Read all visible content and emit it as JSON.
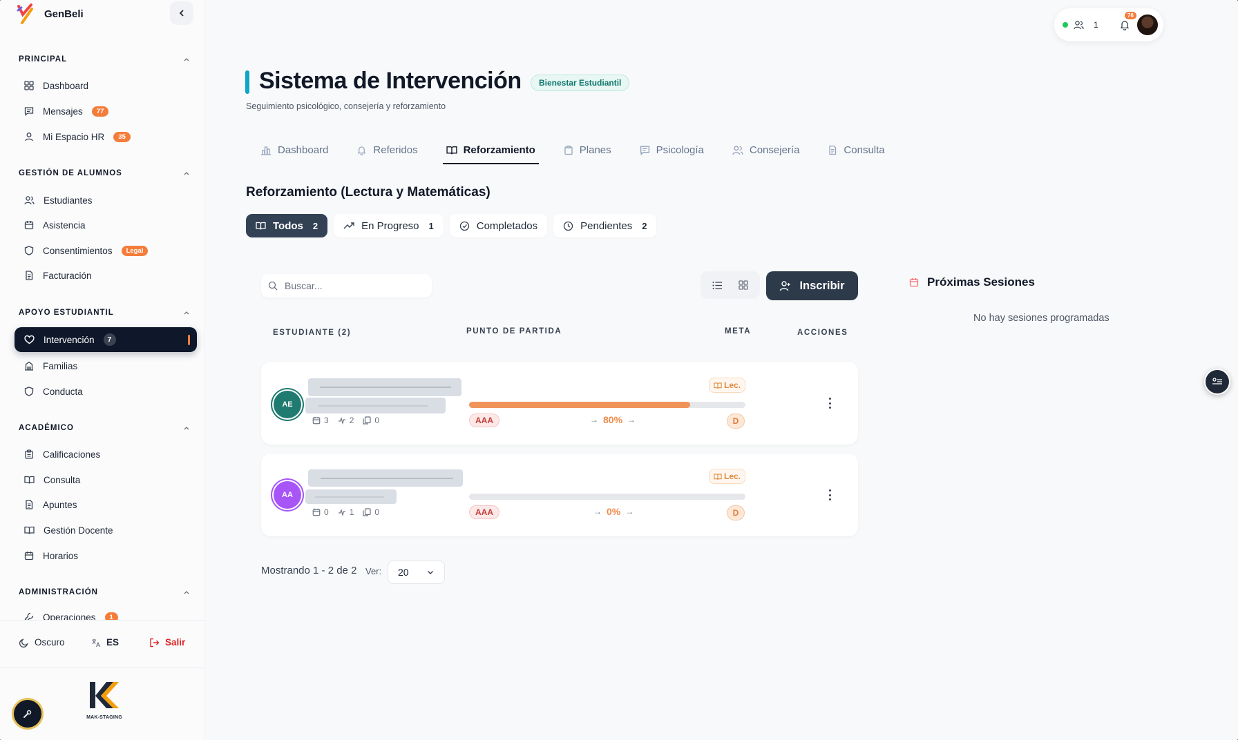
{
  "brand": {
    "name": "GenBeli"
  },
  "sidebar": {
    "sections": [
      {
        "title": "PRINCIPAL"
      },
      {
        "title": "GESTIÓN DE ALUMNOS"
      },
      {
        "title": "APOYO ESTUDIANTIL"
      },
      {
        "title": "ACADÉMICO"
      },
      {
        "title": "ADMINISTRACIÓN"
      }
    ],
    "items": [
      {
        "label": "Dashboard",
        "icon": "grid-icon"
      },
      {
        "label": "Mensajes",
        "badge": "77",
        "icon": "message-icon"
      },
      {
        "label": "Mi Espacio HR",
        "badge": "35",
        "icon": "user-icon"
      },
      {
        "label": "Estudiantes",
        "icon": "users-icon"
      },
      {
        "label": "Asistencia",
        "icon": "calendar-icon"
      },
      {
        "label": "Consentimientos",
        "badge": "Legal",
        "icon": "shield-icon"
      },
      {
        "label": "Facturación",
        "icon": "document-icon"
      },
      {
        "label": "Intervención",
        "badge": "7",
        "icon": "heart-icon"
      },
      {
        "label": "Familias",
        "icon": "building-icon"
      },
      {
        "label": "Conducta",
        "icon": "shield-icon"
      },
      {
        "label": "Calificaciones",
        "icon": "clipboard-icon"
      },
      {
        "label": "Consulta",
        "icon": "book-icon"
      },
      {
        "label": "Apuntes",
        "icon": "document-icon"
      },
      {
        "label": "Gestión Docente",
        "icon": "book-icon"
      },
      {
        "label": "Horarios",
        "icon": "calendar-icon"
      },
      {
        "label": "Operaciones",
        "badge": "1",
        "icon": "wrench-icon"
      }
    ],
    "footer": {
      "theme": "Oscuro",
      "lang": "ES",
      "logout": "Salir"
    },
    "org_logo_text": "MAK-STAGING"
  },
  "topbar": {
    "online_count": "1",
    "notifications": "76"
  },
  "page": {
    "title": "Sistema de Intervención",
    "badge": "Bienestar Estudiantil",
    "subtitle": "Seguimiento psicológico, consejería y reforzamiento"
  },
  "tabs": [
    {
      "label": "Dashboard",
      "icon": "bar-chart-icon"
    },
    {
      "label": "Referidos",
      "icon": "bell-icon"
    },
    {
      "label": "Reforzamiento",
      "icon": "book-icon",
      "active": true
    },
    {
      "label": "Planes",
      "icon": "clipboard-icon"
    },
    {
      "label": "Psicología",
      "icon": "message-icon"
    },
    {
      "label": "Consejería",
      "icon": "users-icon"
    },
    {
      "label": "Consulta",
      "icon": "document-icon"
    }
  ],
  "section": {
    "title": "Reforzamiento (Lectura y Matemáticas)"
  },
  "filters": [
    {
      "label": "Todos",
      "count": "2"
    },
    {
      "label": "En Progreso",
      "count": "1"
    },
    {
      "label": "Completados",
      "count": ""
    },
    {
      "label": "Pendientes",
      "count": "2"
    }
  ],
  "search": {
    "placeholder": "Buscar..."
  },
  "actions": {
    "enroll": "Inscribir"
  },
  "table": {
    "headers": {
      "student": "ESTUDIANTE (2)",
      "start": "PUNTO DE PARTIDA",
      "goal": "META",
      "actions": "ACCIONES"
    },
    "rows": [
      {
        "initials": "AE",
        "avatar_color": "#1f7a6f",
        "sessions": "3",
        "activity": "2",
        "notes": "0",
        "subject": "Lec.",
        "start_level": "AAA",
        "progress_percent": 80,
        "progress_label": "80%",
        "goal": "D"
      },
      {
        "initials": "AA",
        "avatar_color": "#a855f7",
        "sessions": "0",
        "activity": "1",
        "notes": "0",
        "subject": "Lec.",
        "start_level": "AAA",
        "progress_percent": 0,
        "progress_label": "0%",
        "goal": "D"
      }
    ]
  },
  "pagination": {
    "summary": "Mostrando 1 - 2 de 2",
    "per_page_label": "Ver:",
    "per_page": "20"
  },
  "sessions": {
    "title": "Próximas Sesiones",
    "empty": "No hay sesiones programadas"
  }
}
